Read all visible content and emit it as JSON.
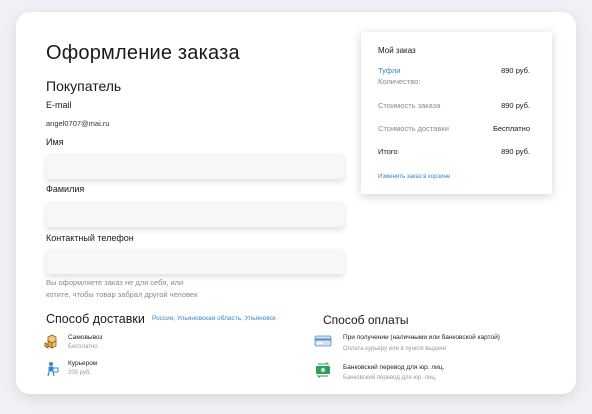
{
  "checkout": {
    "title": "Оформление заказа",
    "buyer_heading": "Покупатель",
    "email_label": "E-mail",
    "email_value": "angel0707@mai.ru",
    "name_label": "Имя",
    "surname_label": "Фамилия",
    "phone_label": "Контактный телефон",
    "note_line1": "Вы оформляете заказ не для себя, или",
    "note_line2": "котите, чтобы товар забрал другой человек"
  },
  "delivery": {
    "heading": "Способ доставки",
    "location": "Россия, Ульяновская область, Ульяновск",
    "options": [
      {
        "title": "Самовывоз",
        "sub": "Бесплатно",
        "icon": "boxes-icon"
      },
      {
        "title": "Курьером",
        "sub": "200 руб.",
        "icon": "courier-icon"
      }
    ]
  },
  "payment": {
    "heading": "Способ оплаты",
    "options": [
      {
        "title": "При получении (наличными или банковской картой)",
        "sub": "Оплата курьеру или в пункте выдачи",
        "icon": "card-icon"
      },
      {
        "title": "Банковский перевод для юр. лиц.",
        "sub": "Банковский перевод для юр. лиц.",
        "icon": "bank-transfer-icon"
      }
    ]
  },
  "summary": {
    "heading": "Мой заказ",
    "item_name": "Туфли",
    "item_price": "890 руб.",
    "quantity_label": "Количество:",
    "order_cost_label": "Стоимость заказа",
    "order_cost_value": "890 руб.",
    "delivery_cost_label": "Стоимость доставки",
    "delivery_cost_value": "Бесплатно",
    "total_label": "Итого",
    "total_value": "890 руб.",
    "edit_link": "Изменить заказ в корзине"
  },
  "colors": {
    "accent": "#3a86c8",
    "background": "#f0f1f4"
  }
}
